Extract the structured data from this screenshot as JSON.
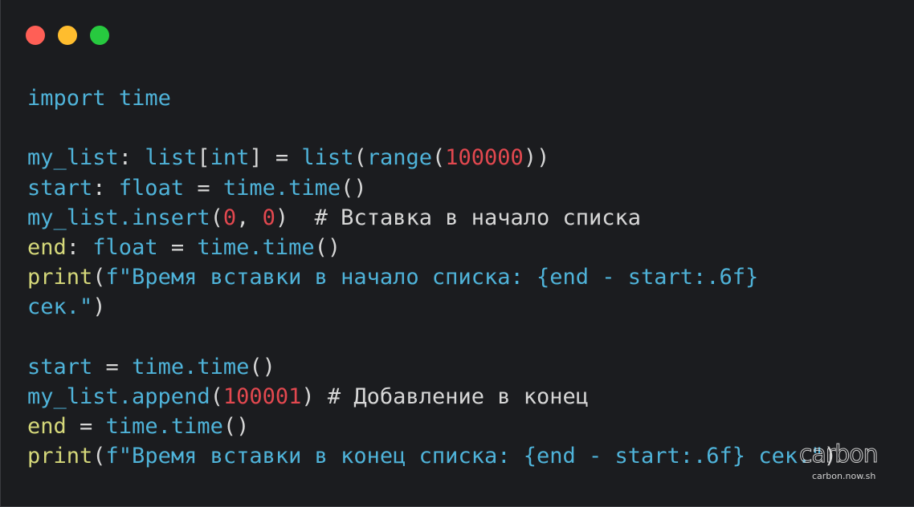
{
  "window": {
    "controls": [
      "close",
      "minimize",
      "zoom"
    ],
    "colors": {
      "background": "#1b1c1f",
      "close": "#ff5f56",
      "minimize": "#ffbd2e",
      "zoom": "#27c93f"
    }
  },
  "code_lines": [
    [
      [
        "kw",
        "import"
      ],
      [
        "pl",
        " "
      ],
      [
        "id",
        "time"
      ]
    ],
    [],
    [
      [
        "id",
        "my_list"
      ],
      [
        "pl",
        ": "
      ],
      [
        "id",
        "list"
      ],
      [
        "pl",
        "["
      ],
      [
        "id",
        "int"
      ],
      [
        "pl",
        "] = "
      ],
      [
        "id",
        "list"
      ],
      [
        "pl",
        "("
      ],
      [
        "id",
        "range"
      ],
      [
        "pl",
        "("
      ],
      [
        "num",
        "100000"
      ],
      [
        "pl",
        "))"
      ]
    ],
    [
      [
        "id",
        "start"
      ],
      [
        "pl",
        ": "
      ],
      [
        "id",
        "float"
      ],
      [
        "pl",
        " = "
      ],
      [
        "id",
        "time.time"
      ],
      [
        "pl",
        "()"
      ]
    ],
    [
      [
        "id",
        "my_list.insert"
      ],
      [
        "pl",
        "("
      ],
      [
        "num",
        "0"
      ],
      [
        "pl",
        ", "
      ],
      [
        "num",
        "0"
      ],
      [
        "pl",
        ")  "
      ],
      [
        "cm",
        "# Вставка в начало списка"
      ]
    ],
    [
      [
        "yl",
        "end"
      ],
      [
        "pl",
        ": "
      ],
      [
        "id",
        "float"
      ],
      [
        "pl",
        " = "
      ],
      [
        "id",
        "time.time"
      ],
      [
        "pl",
        "()"
      ]
    ],
    [
      [
        "yl",
        "print"
      ],
      [
        "pl",
        "("
      ],
      [
        "str",
        "f\"Время вставки в начало списка: {end - start:.6f}"
      ]
    ],
    [
      [
        "str",
        "сек.\""
      ],
      [
        "pl",
        ")"
      ]
    ],
    [],
    [
      [
        "id",
        "start"
      ],
      [
        "pl",
        " = "
      ],
      [
        "id",
        "time.time"
      ],
      [
        "pl",
        "()"
      ]
    ],
    [
      [
        "id",
        "my_list.append"
      ],
      [
        "pl",
        "("
      ],
      [
        "num",
        "100001"
      ],
      [
        "pl",
        ") "
      ],
      [
        "cm",
        "# Добавление в конец"
      ]
    ],
    [
      [
        "yl",
        "end"
      ],
      [
        "pl",
        " = "
      ],
      [
        "id",
        "time.time"
      ],
      [
        "pl",
        "()"
      ]
    ],
    [
      [
        "yl",
        "print"
      ],
      [
        "pl",
        "("
      ],
      [
        "str",
        "f\"Время вставки в конец списка: {end - start:.6f} сек.\""
      ],
      [
        "pl",
        ")"
      ]
    ]
  ],
  "watermark": {
    "logo": "carbon",
    "url": "carbon.now.sh"
  }
}
